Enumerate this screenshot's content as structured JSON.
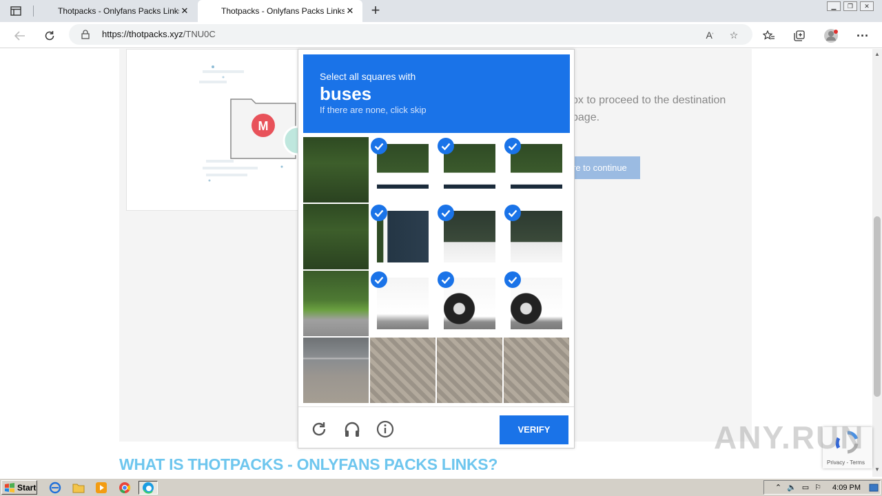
{
  "browser": {
    "tabs": [
      {
        "title": "Thotpacks - Onlyfans Packs Links",
        "active": false
      },
      {
        "title": "Thotpacks - Onlyfans Packs Links",
        "active": true
      }
    ],
    "url_domain": "https://thotpacks.xyz",
    "url_path": "/TNU0C"
  },
  "page": {
    "text_fragment": "ox to proceed to the destination page.",
    "button_fragment": "re to continue",
    "heading": "WHAT IS THOTPACKS - ONLYFANS PACKS LINKS?"
  },
  "captcha": {
    "instruction": "Select all squares with",
    "keyword": "buses",
    "hint": "If there are none, click skip",
    "verify_label": "VERIFY",
    "grid": [
      [
        false,
        true,
        true,
        true
      ],
      [
        false,
        true,
        true,
        true
      ],
      [
        false,
        true,
        true,
        true
      ],
      [
        false,
        false,
        false,
        false
      ]
    ],
    "accent_color": "#1a73e8"
  },
  "badge": {
    "links": "Privacy - Terms"
  },
  "watermark": "ANY.RUN",
  "taskbar": {
    "start_label": "Start",
    "clock": "4:09 PM"
  }
}
